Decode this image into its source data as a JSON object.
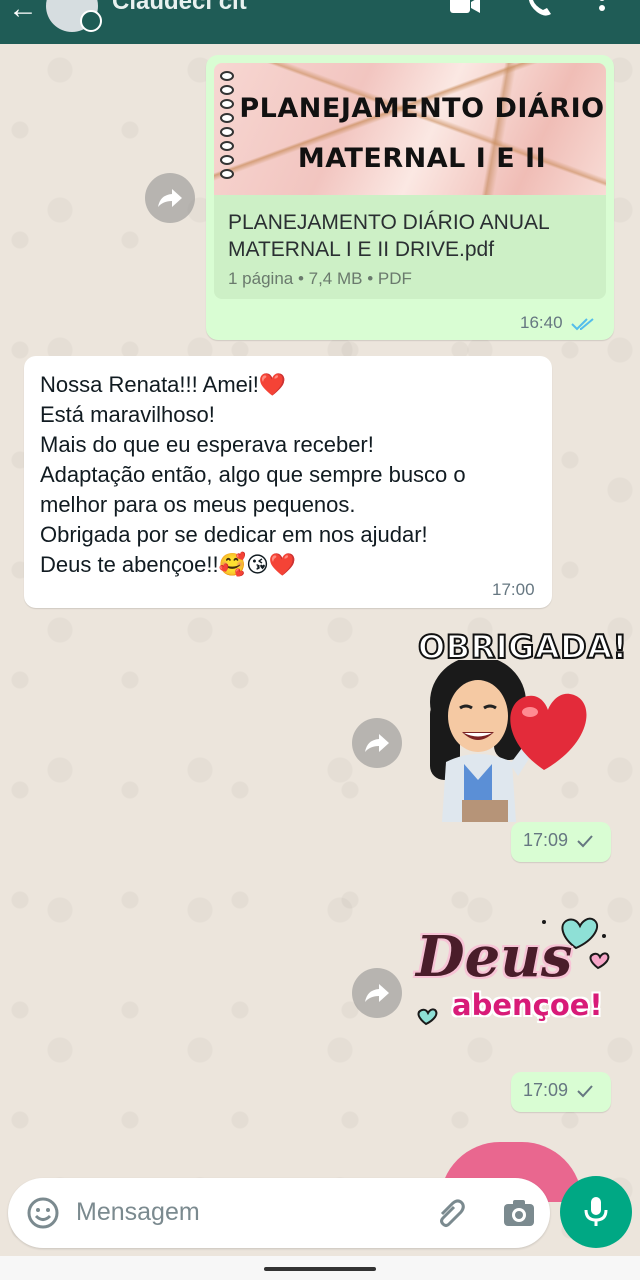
{
  "header": {
    "contact_name": "Claudeci cit",
    "icons": [
      "back-arrow-icon",
      "avatar",
      "video-call-icon",
      "voice-call-icon",
      "more-menu-icon"
    ]
  },
  "messages": {
    "pdf": {
      "thumb_line1": "PLANEJAMENTO DIÁRIO",
      "thumb_line2": "MATERNAL I E II",
      "file_name_line1": "PLANEJAMENTO DIÁRIO ANUAL",
      "file_name_line2": "MATERNAL I E II DRIVE.pdf",
      "meta": "1 página • 7,4 MB • PDF",
      "time": "16:40"
    },
    "incoming": {
      "lines": [
        "Nossa Renata!!! Amei!❤️",
        "Está maravilhoso!",
        "Mais do que eu esperava receber!",
        "Adaptação então, algo que sempre busco o",
        "melhor para os meus pequenos.",
        "Obrigada por se dedicar em nos  ajudar!",
        "Deus te abençoe!!🥰😘❤️"
      ],
      "time": "17:00"
    },
    "sticker1": {
      "text": "OBRIGADA!",
      "time": "17:09"
    },
    "sticker2": {
      "text_top": "Deus",
      "text_bottom": "abençoe!",
      "time": "17:09"
    }
  },
  "input": {
    "placeholder": "Mensagem"
  },
  "colors": {
    "header": "#1f5c56",
    "outgoing": "#d9fdd3",
    "incoming": "#ffffff",
    "accent": "#00a884",
    "read_ticks": "#53bdeb"
  }
}
